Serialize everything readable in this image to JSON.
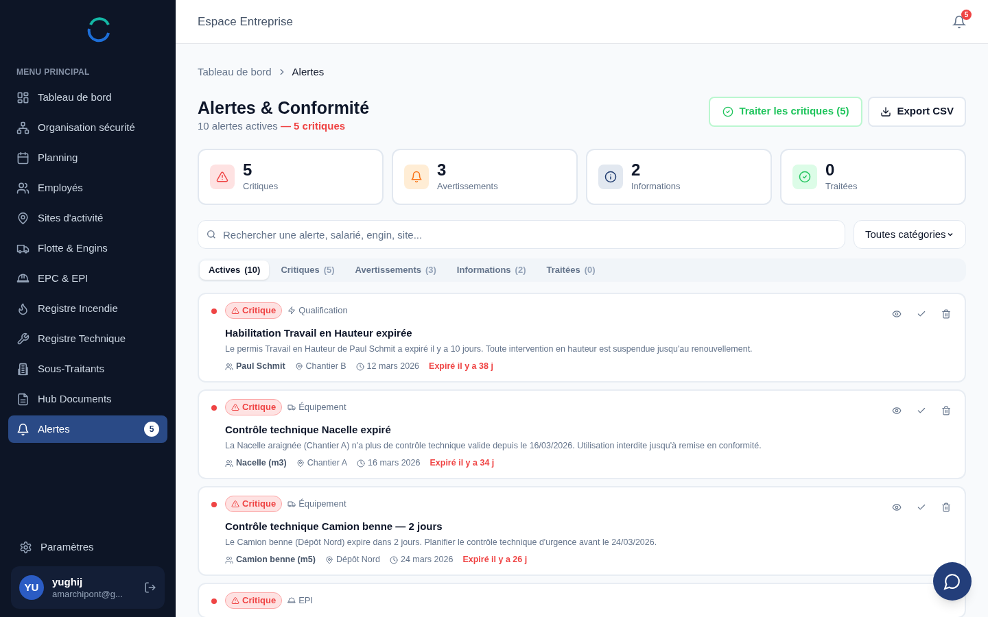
{
  "sidebar": {
    "section_title": "MENU PRINCIPAL",
    "items": [
      {
        "label": "Tableau de bord",
        "selected": false
      },
      {
        "label": "Organisation sécurité",
        "selected": false
      },
      {
        "label": "Planning",
        "selected": false
      },
      {
        "label": "Employés",
        "selected": false
      },
      {
        "label": "Sites d'activité",
        "selected": false
      },
      {
        "label": "Flotte & Engins",
        "selected": false
      },
      {
        "label": "EPC & EPI",
        "selected": false
      },
      {
        "label": "Registre Incendie",
        "selected": false
      },
      {
        "label": "Registre Technique",
        "selected": false
      },
      {
        "label": "Sous-Traitants",
        "selected": false
      },
      {
        "label": "Hub Documents",
        "selected": false
      },
      {
        "label": "Alertes",
        "selected": true,
        "badge": "5"
      }
    ],
    "settings": "Paramètres",
    "user": {
      "initials": "YU",
      "name": "yughij",
      "email": "amarchipont@g..."
    }
  },
  "header": {
    "title": "Espace Entreprise",
    "notifications": "5"
  },
  "breadcrumb": [
    "Tableau de bord",
    "Alertes"
  ],
  "page": {
    "title": "Alertes & Conformité",
    "subtitle": "10 alertes actives",
    "subtitle_highlight": "— 5 critiques"
  },
  "actions": [
    {
      "label": "Traiter les critiques (5)",
      "kind": "primary"
    },
    {
      "label": "Export CSV",
      "kind": "export"
    }
  ],
  "stats": [
    {
      "value": "5",
      "label": "Critiques",
      "kind": "critical"
    },
    {
      "value": "3",
      "label": "Avertissements",
      "kind": "warning"
    },
    {
      "value": "2",
      "label": "Informations",
      "kind": "info"
    },
    {
      "value": "0",
      "label": "Traitées",
      "kind": "done"
    }
  ],
  "search": {
    "placeholder": "Rechercher une alerte, salarié, engin, site..."
  },
  "category_select": {
    "value": "Toutes catégories"
  },
  "tabs": [
    {
      "label": "Actives",
      "count": "(10)",
      "selected": true
    },
    {
      "label": "Critiques",
      "count": "(5)",
      "selected": false
    },
    {
      "label": "Avertissements",
      "count": "(3)",
      "selected": false
    },
    {
      "label": "Informations",
      "count": "(2)",
      "selected": false
    },
    {
      "label": "Traitées",
      "count": "(0)",
      "selected": false
    }
  ],
  "alerts": [
    {
      "severity": "Critique",
      "kind": "critical",
      "category": "Qualification",
      "title": "Habilitation Travail en Hauteur expirée",
      "description": "Le permis Travail en Hauteur de Paul Schmit a expiré il y a 10 jours. Toute intervention en hauteur est suspendue jusqu'au renouvellement.",
      "subject": "Paul Schmit",
      "site": "Chantier B",
      "date": "12 mars 2026",
      "status": "Expiré il y a 38 j"
    },
    {
      "severity": "Critique",
      "kind": "critical",
      "category": "Équipement",
      "title": "Contrôle technique Nacelle expiré",
      "description": "La Nacelle araignée (Chantier A) n'a plus de contrôle technique valide depuis le 16/03/2026. Utilisation interdite jusqu'à remise en conformité.",
      "subject": "Nacelle (m3)",
      "site": "Chantier A",
      "date": "16 mars 2026",
      "status": "Expiré il y a 34 j"
    },
    {
      "severity": "Critique",
      "kind": "critical",
      "category": "Équipement",
      "title": "Contrôle technique Camion benne — 2 jours",
      "description": "Le Camion benne (Dépôt Nord) expire dans 2 jours. Planifier le contrôle technique d'urgence avant le 24/03/2026.",
      "subject": "Camion benne (m5)",
      "site": "Dépôt Nord",
      "date": "24 mars 2026",
      "status": "Expiré il y a 26 j"
    },
    {
      "severity": "Critique",
      "kind": "critical",
      "category": "EPI"
    }
  ]
}
